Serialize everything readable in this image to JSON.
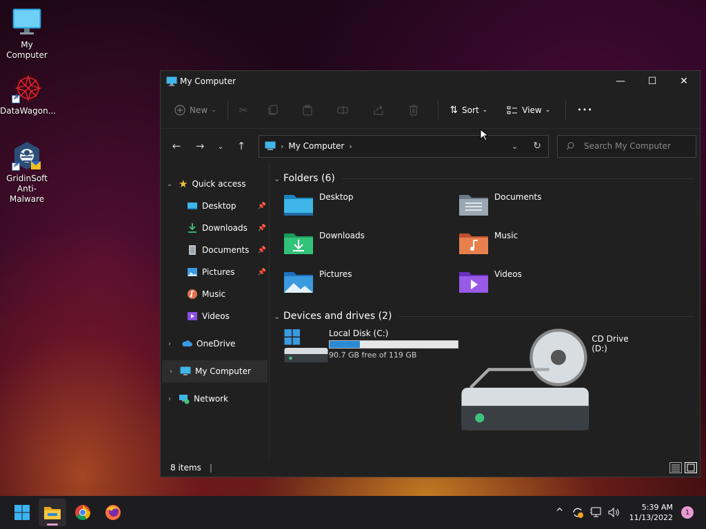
{
  "desktop": {
    "icons": [
      {
        "label": "My Computer",
        "icon": "monitor-icon"
      },
      {
        "label": "DataWagon...",
        "icon": "datawagon-icon"
      },
      {
        "label": "GridinSoft Anti-Malware",
        "icon": "gridinsoft-icon"
      }
    ]
  },
  "window": {
    "title": "My Computer",
    "controls": {
      "minimize": "—",
      "maximize": "☐",
      "close": "✕"
    }
  },
  "toolbar": {
    "new_label": "New",
    "sort_label": "Sort",
    "view_label": "View",
    "more_label": "•••"
  },
  "address": {
    "location": "My Computer",
    "search_placeholder": "Search My Computer"
  },
  "sidebar": {
    "quick_access": "Quick access",
    "items": [
      {
        "label": "Desktop",
        "pinned": true
      },
      {
        "label": "Downloads",
        "pinned": true
      },
      {
        "label": "Documents",
        "pinned": true
      },
      {
        "label": "Pictures",
        "pinned": true
      },
      {
        "label": "Music",
        "pinned": false
      },
      {
        "label": "Videos",
        "pinned": false
      }
    ],
    "onedrive": "OneDrive",
    "my_computer": "My Computer",
    "network": "Network"
  },
  "content": {
    "folders_header": "Folders (6)",
    "folders": [
      {
        "name": "Desktop"
      },
      {
        "name": "Documents"
      },
      {
        "name": "Downloads"
      },
      {
        "name": "Music"
      },
      {
        "name": "Pictures"
      },
      {
        "name": "Videos"
      }
    ],
    "drives_header": "Devices and drives (2)",
    "drives": [
      {
        "name": "Local Disk (C:)",
        "free_text": "90.7 GB free of 119 GB",
        "used_fraction": 0.238
      },
      {
        "name": "CD Drive (D:)"
      }
    ]
  },
  "status": {
    "item_count": "8 items"
  },
  "taskbar": {
    "time": "5:39 AM",
    "date": "11/13/2022",
    "notification_count": "1"
  },
  "colors": {
    "accent": "#2a8ad4",
    "window_bg": "#202020",
    "taskbar_bg": "#1d1c1e",
    "badge": "#e89ad2"
  }
}
